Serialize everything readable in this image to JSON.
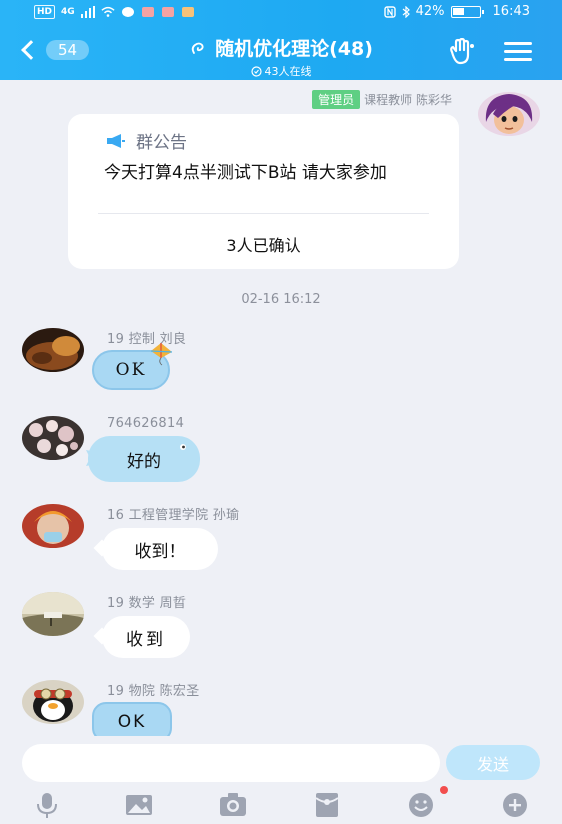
{
  "status_bar": {
    "left_chip": "HD",
    "net": "4G",
    "battery_level": 42,
    "battery": "42%",
    "time": "16:43"
  },
  "header": {
    "unread": "54",
    "title": "随机优化理论(48)",
    "online": "43人在线"
  },
  "admin": {
    "badge": "管理员",
    "name": "课程教师 陈彩华"
  },
  "notice": {
    "title": "群公告",
    "text": "今天打算4点半测试下B站 请大家参加",
    "confirmed": "3人已确认"
  },
  "timestamp": "02-16 16:12",
  "messages": [
    {
      "sender": "19 控制 刘良",
      "text": "OK"
    },
    {
      "sender": "764626814",
      "text": "好的"
    },
    {
      "sender": "16 工程管理学院 孙瑜",
      "text": "收到！"
    },
    {
      "sender": "19 数学 周晢",
      "text": "收到"
    },
    {
      "sender": "19 物院 陈宏圣",
      "text": "OK"
    }
  ],
  "input": {
    "placeholder": "",
    "send": "发送"
  },
  "colors": {
    "accent": "#1ea9f2",
    "admin_badge": "#5fcf83",
    "notify_dot": "#f24e4e"
  },
  "toolbar": [
    "mic-icon",
    "image-icon",
    "camera-icon",
    "redpacket-icon",
    "emoji-icon",
    "plus-icon"
  ]
}
